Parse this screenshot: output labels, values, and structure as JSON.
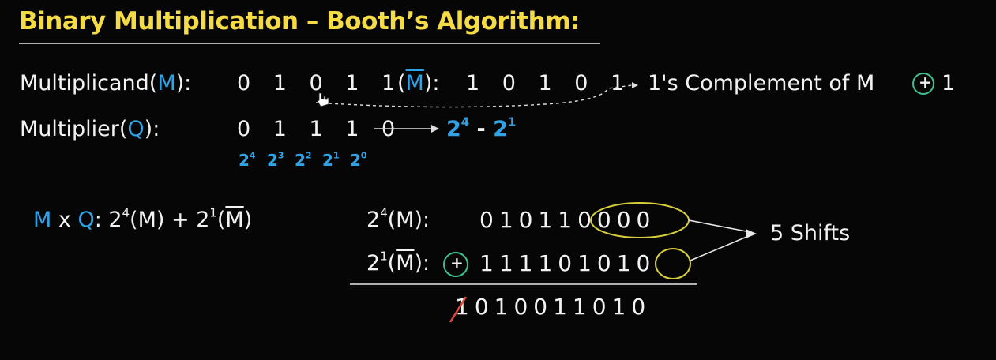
{
  "title": "Binary Multiplication – Booth’s Algorithm:",
  "row1": {
    "label_prefix": "Multiplicand(",
    "label_var": "M",
    "label_suffix": "):",
    "bits": "0 1 0 1 1",
    "comp_open": "(",
    "comp_var": "M",
    "comp_close": "):",
    "comp_bits": "1 0 1 0 1",
    "note": "1's Complement of M",
    "plus": "+",
    "one": "1"
  },
  "row2": {
    "label_prefix": "Multiplier(",
    "label_var": "Q",
    "label_suffix": "):",
    "bits": "0 1 1 1 0",
    "result_base1": "2",
    "result_exp1": "4",
    "result_minus": " - ",
    "result_base2": "2",
    "result_exp2": "1"
  },
  "powers": [
    {
      "base": "2",
      "exp": "4"
    },
    {
      "base": "2",
      "exp": "3"
    },
    {
      "base": "2",
      "exp": "2"
    },
    {
      "base": "2",
      "exp": "1"
    },
    {
      "base": "2",
      "exp": "0"
    }
  ],
  "formula": {
    "m": "M",
    "x": " x ",
    "q": "Q",
    "colon": ": ",
    "t1_base": "2",
    "t1_exp": "4",
    "t1_arg": "(M) + ",
    "t2_base": "2",
    "t2_exp": "1",
    "t2_open": "(",
    "t2_var": "M",
    "t2_close": ")"
  },
  "calc": {
    "line1_base": "2",
    "line1_exp": "4",
    "line1_arg": "(M):",
    "line1_bits": "01011",
    "line1_zeros": "0000",
    "line2_base": "2",
    "line2_exp": "1",
    "line2_open": "(",
    "line2_var": "M",
    "line2_close": "):",
    "line2_plus": "+",
    "line2_bits": "11110101",
    "line2_last": "0",
    "carry": "1",
    "result": "010011010",
    "shifts_label": "5 Shifts"
  },
  "colors": {
    "title": "#f5dc45",
    "accent_blue": "#2fa3e6",
    "annotation_yellow": "#d8cf3a",
    "annotation_green": "#3fbf8f",
    "strike_red": "#e0473a"
  }
}
